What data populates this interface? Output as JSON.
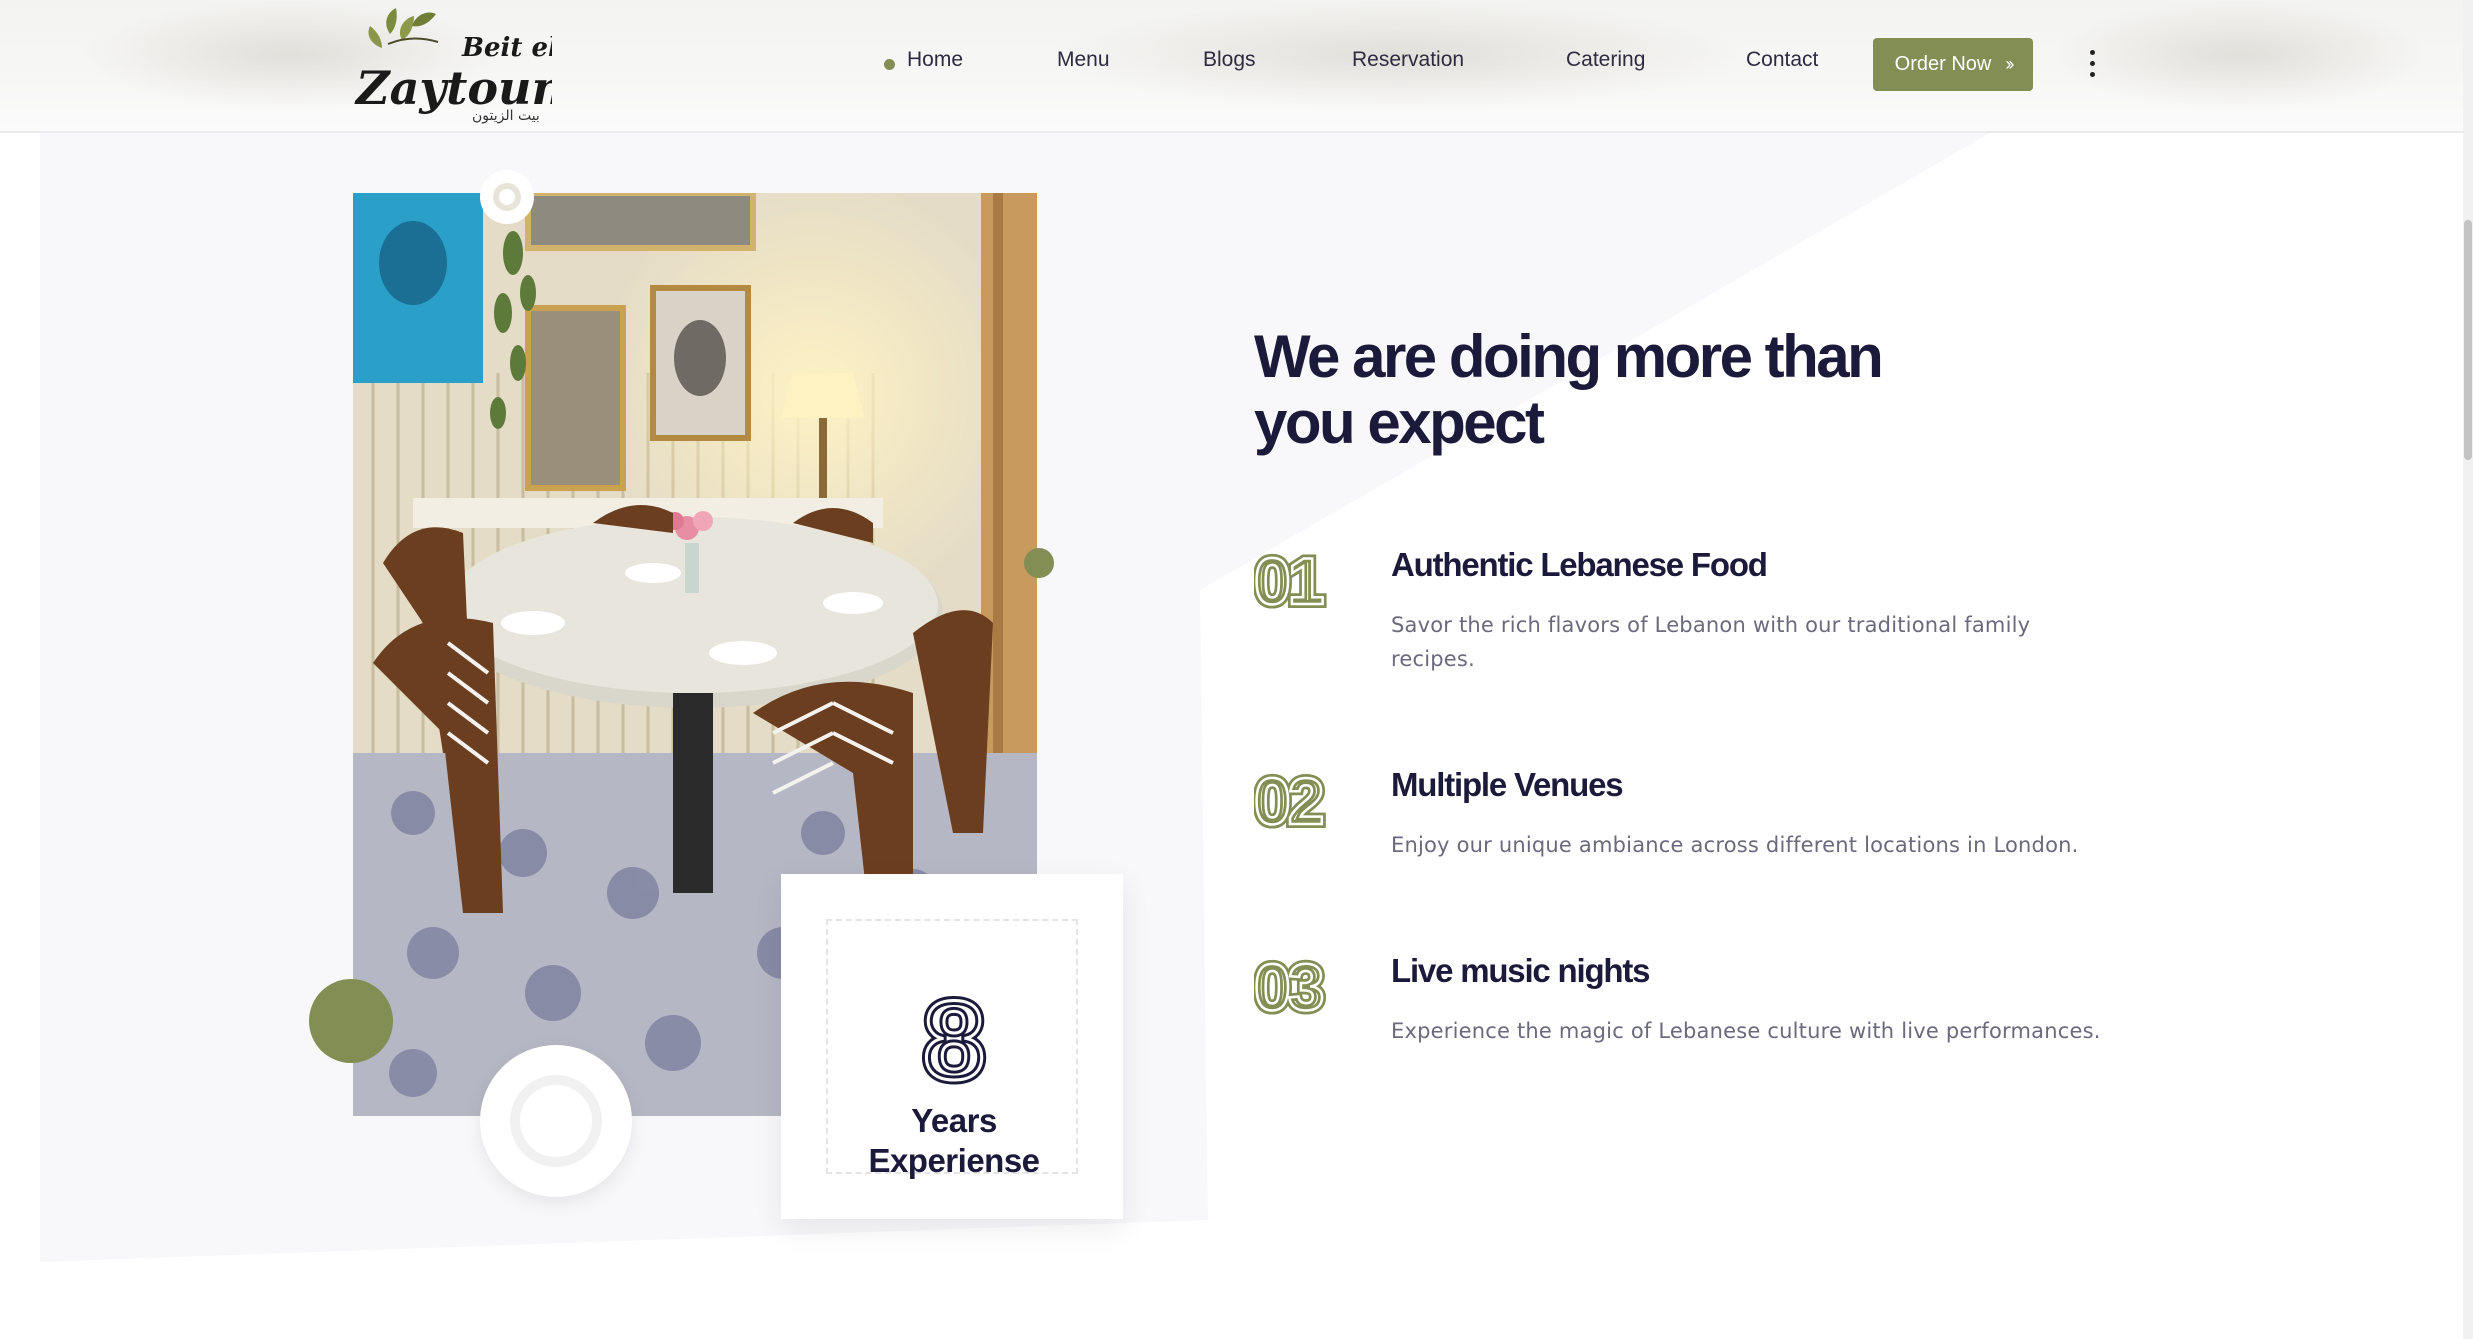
{
  "brand": {
    "logo_text_line1": "Beit el",
    "logo_text_line2": "Zaytoun",
    "logo_text_arabic": "بيت الزيتون"
  },
  "nav": {
    "items": [
      {
        "label": "Home",
        "active": true
      },
      {
        "label": "Menu",
        "active": false
      },
      {
        "label": "Blogs",
        "active": false
      },
      {
        "label": "Reservation",
        "active": false
      },
      {
        "label": "Catering",
        "active": false
      },
      {
        "label": "Contact",
        "active": false
      }
    ],
    "order_button": {
      "label": "Order Now",
      "icon": "double-chevron-right-icon"
    },
    "more_icon": "kebab-vertical-icon"
  },
  "colors": {
    "accent": "#838e55",
    "heading": "#1c1a3a",
    "body_text": "#6b6a7d",
    "section_bg": "#f8f8fa"
  },
  "about": {
    "heading": "We are doing more than you expect",
    "experience": {
      "number": "8",
      "label": "Years Experiense"
    },
    "features": [
      {
        "number": "01",
        "title": "Authentic Lebanese Food",
        "text": "Savor the rich flavors of Lebanon with our traditional family recipes."
      },
      {
        "number": "02",
        "title": "Multiple Venues",
        "text": "Enjoy our unique ambiance across different locations in London."
      },
      {
        "number": "03",
        "title": "Live music nights",
        "text": "Experience the magic of Lebanese culture with live performances."
      }
    ]
  }
}
